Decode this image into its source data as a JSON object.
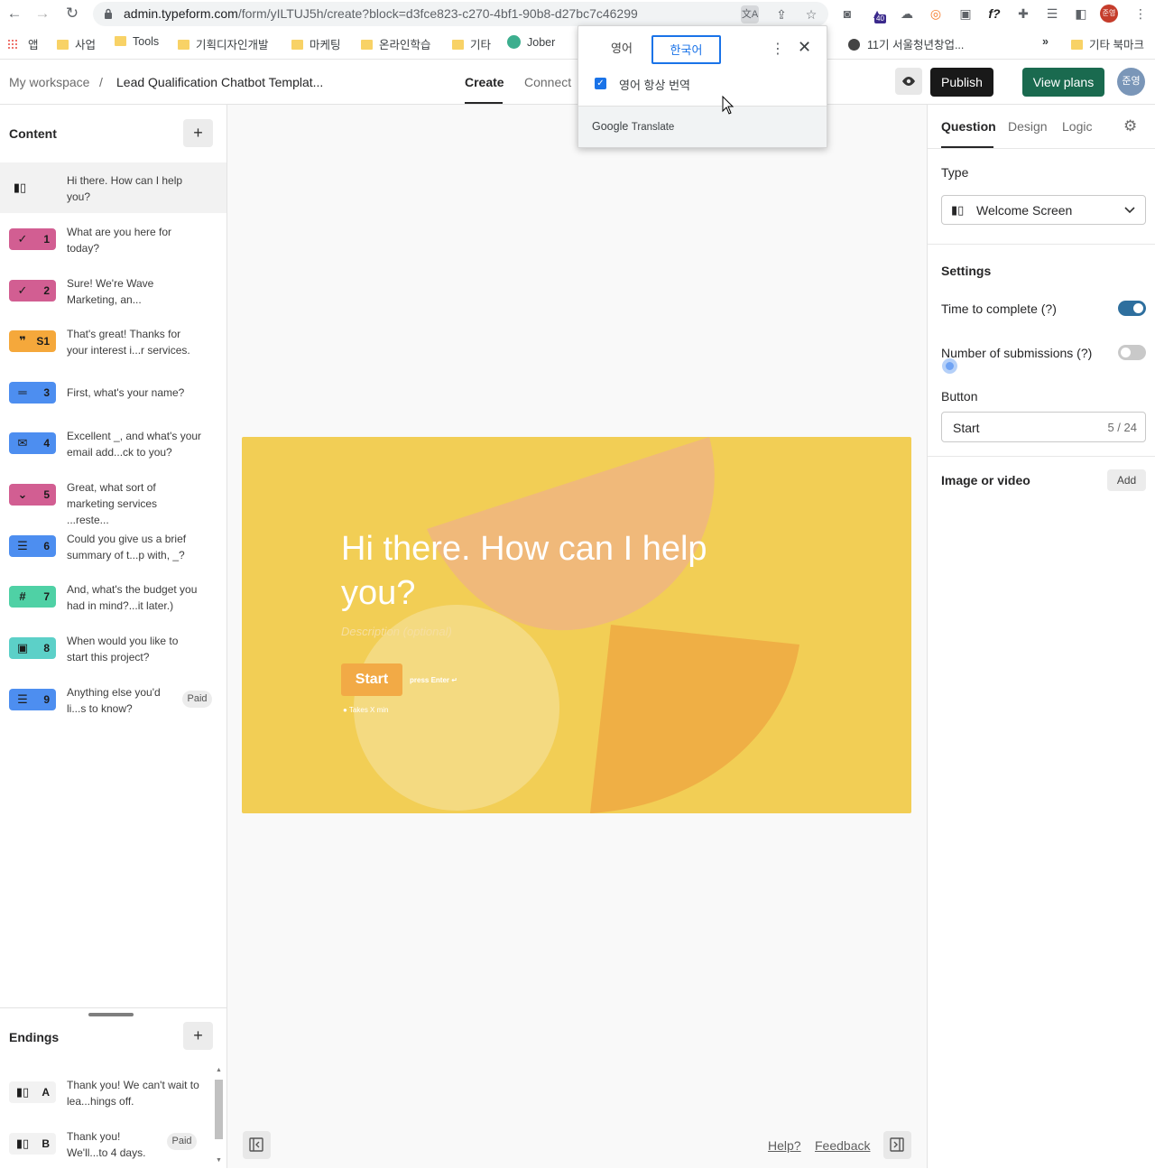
{
  "browser": {
    "url_host": "admin.typeform.com",
    "url_path": "/form/yILTUJ5h/create?block=d3fce823-c270-4bf1-90b8-d27bc7c46299",
    "extension_badge": "40",
    "profile_initials": "준영",
    "bookmarks": [
      "앱",
      "사업",
      "Tools",
      "기획디자인개발",
      "마케팅",
      "온라인학습",
      "기타",
      "Jober",
      "11기 서울청년창업...",
      "»",
      "기타 북마크"
    ]
  },
  "translate_popup": {
    "lang_source": "영어",
    "lang_target": "한국어",
    "always_translate": "영어 항상 번역",
    "footer_google": "Google",
    "footer_translate": "Translate"
  },
  "header": {
    "workspace": "My workspace",
    "separator": "/",
    "form_title": "Lead Qualification Chatbot Templat...",
    "tabs": [
      "Create",
      "Connect"
    ],
    "publish": "Publish",
    "view_plans": "View plans",
    "avatar_initials": "준영"
  },
  "content_panel": {
    "title": "Content",
    "questions": [
      {
        "number": "",
        "text": "Hi there. How can I help you?",
        "color": "#f2ede3"
      },
      {
        "number": "1",
        "text": "What are you here for today?",
        "color": "#d25e92"
      },
      {
        "number": "2",
        "text": "Sure! We're Wave Marketing, an...",
        "color": "#d25e92"
      },
      {
        "number": "S1",
        "text": "That's great! Thanks for your interest i...r services.",
        "color": "#f5a83b"
      },
      {
        "number": "3",
        "text": "First, what's your name?",
        "color": "#4d8ef0"
      },
      {
        "number": "4",
        "text": "Excellent _, and what's your email add...ck to you?",
        "color": "#4d8ef0"
      },
      {
        "number": "5",
        "text": "Great, what sort of marketing services ...reste...",
        "color": "#d25e92"
      },
      {
        "number": "6",
        "text": "Could you give us a brief summary of t...p with, _?",
        "color": "#4d8ef0"
      },
      {
        "number": "7",
        "text": "And, what's the budget you had in mind?...it later.)",
        "color": "#4fd1a5"
      },
      {
        "number": "8",
        "text": "When would you like to start this project?",
        "color": "#5cd0c8"
      },
      {
        "number": "9",
        "text": "Anything else you'd li...s to know?",
        "color": "#4d8ef0",
        "paid": "Paid"
      }
    ]
  },
  "endings_panel": {
    "title": "Endings",
    "items": [
      {
        "letter": "A",
        "text": "Thank you! We can't wait to lea...hings off."
      },
      {
        "letter": "B",
        "text": "Thank you! We'll...to 4 days.",
        "paid": "Paid"
      }
    ]
  },
  "welcome_card": {
    "title": "Hi there. How can I help you?",
    "description_placeholder": "Description (optional)",
    "start_button": "Start",
    "press_enter": "press Enter ↵",
    "time_hint": "Takes X min",
    "background_color": "#f2ce55"
  },
  "canvas_footer": {
    "help": "Help?",
    "feedback": "Feedback"
  },
  "right_panel": {
    "tabs": [
      "Question",
      "Design",
      "Logic"
    ],
    "type_label": "Type",
    "type_value": "Welcome Screen",
    "settings_label": "Settings",
    "time_to_complete": "Time to complete (?)",
    "time_to_complete_on": true,
    "number_of_submissions": "Number of submissions (?)",
    "number_of_submissions_on": false,
    "button_label": "Button",
    "button_value": "Start",
    "button_count": "5 / 24",
    "image_or_video": "Image or video",
    "add": "Add"
  }
}
